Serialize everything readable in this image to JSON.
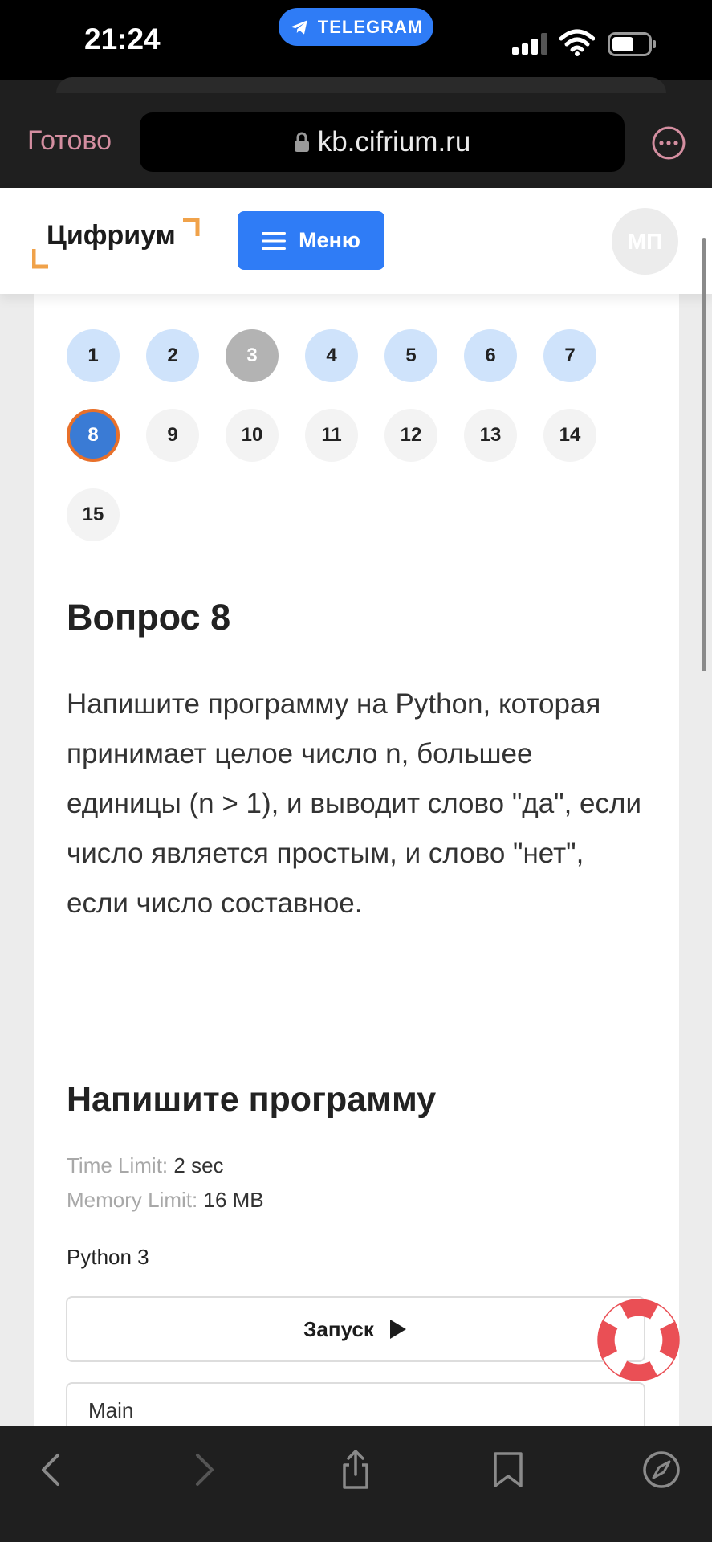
{
  "status_bar": {
    "time": "21:24",
    "back_app": "TELEGRAM"
  },
  "browser": {
    "done_label": "Готово",
    "url": "kb.cifrium.ru"
  },
  "site": {
    "logo_text": "Цифриум",
    "menu_label": "Меню",
    "avatar_initials": "МП",
    "accent_color": "#2f7cf6",
    "logo_corner_color": "#f0a24a"
  },
  "question_nav": {
    "items": [
      {
        "label": "1",
        "state": "answered"
      },
      {
        "label": "2",
        "state": "answered"
      },
      {
        "label": "3",
        "state": "skipped"
      },
      {
        "label": "4",
        "state": "answered"
      },
      {
        "label": "5",
        "state": "answered"
      },
      {
        "label": "6",
        "state": "answered"
      },
      {
        "label": "7",
        "state": "answered"
      },
      {
        "label": "8",
        "state": "current"
      },
      {
        "label": "9",
        "state": "unanswered"
      },
      {
        "label": "10",
        "state": "unanswered"
      },
      {
        "label": "11",
        "state": "unanswered"
      },
      {
        "label": "12",
        "state": "unanswered"
      },
      {
        "label": "13",
        "state": "unanswered"
      },
      {
        "label": "14",
        "state": "unanswered"
      },
      {
        "label": "15",
        "state": "unanswered"
      }
    ]
  },
  "question": {
    "title": "Вопрос 8",
    "text": "Напишите программу на Python, которая принимает целое число n, большее единицы (n > 1), и выводит слово \"да\", если число является простым, и слово \"нет\", если число составное."
  },
  "task": {
    "title": "Напишите программу",
    "time_limit_label": "Time Limit:",
    "time_limit_value": "2 sec",
    "memory_limit_label": "Memory Limit:",
    "memory_limit_value": "16 MB",
    "language": "Python 3",
    "run_label": "Запуск",
    "editor_tab": "Main"
  },
  "icons": {
    "toolbar": [
      "back-icon",
      "forward-icon",
      "share-icon",
      "bookmarks-icon",
      "compass-icon"
    ]
  }
}
